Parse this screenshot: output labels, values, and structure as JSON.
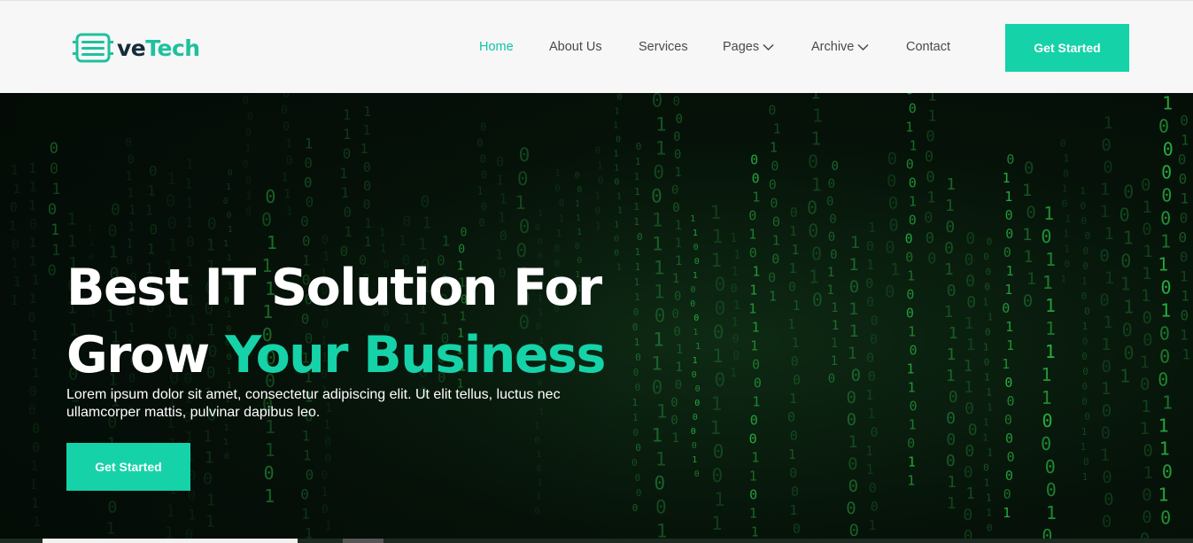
{
  "brand": {
    "name_part1": "ve",
    "name_part2": "Tech",
    "accent": "#16d2a8",
    "dark": "#152d3a"
  },
  "nav": {
    "items": [
      {
        "label": "Home",
        "active": true,
        "dropdown": false
      },
      {
        "label": "About Us",
        "active": false,
        "dropdown": false
      },
      {
        "label": "Services",
        "active": false,
        "dropdown": false
      },
      {
        "label": "Pages",
        "active": false,
        "dropdown": true
      },
      {
        "label": "Archive",
        "active": false,
        "dropdown": true
      },
      {
        "label": "Contact",
        "active": false,
        "dropdown": false
      }
    ],
    "cta_label": "Get Started"
  },
  "hero": {
    "title_line1": "Best IT Solution For",
    "title_line2_plain": "Grow ",
    "title_line2_accent": "Your Business",
    "description": "Lorem ipsum dolor sit amet, consectetur adipiscing elit. Ut elit tellus, luctus nec ullamcorper mattis, pulvinar dapibus leo.",
    "cta_label": "Get Started",
    "background": "binary-matrix-rain"
  },
  "icons": {
    "logo": "chip-server-icon",
    "dropdown": "chevron-down-icon"
  }
}
